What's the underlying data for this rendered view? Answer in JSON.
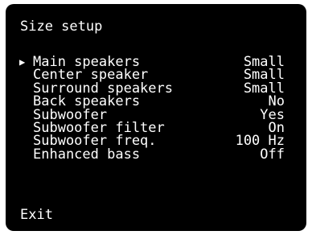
{
  "screen": {
    "title": "Size setup",
    "cursor_glyph": "▶",
    "selected_index": 0,
    "items": [
      {
        "label": "Main speakers",
        "value": "Small"
      },
      {
        "label": "Center speaker",
        "value": "Small"
      },
      {
        "label": "Surround speakers",
        "value": "Small"
      },
      {
        "label": "Back speakers",
        "value": "No"
      },
      {
        "label": "Subwoofer",
        "value": "Yes"
      },
      {
        "label": "Subwoofer filter",
        "value": "On"
      },
      {
        "label": "Subwoofer freq.",
        "value": "100 Hz"
      },
      {
        "label": "Enhanced bass",
        "value": "Off"
      }
    ],
    "exit_label": "Exit"
  },
  "colors": {
    "background": "#000000",
    "text": "#ffffff"
  }
}
